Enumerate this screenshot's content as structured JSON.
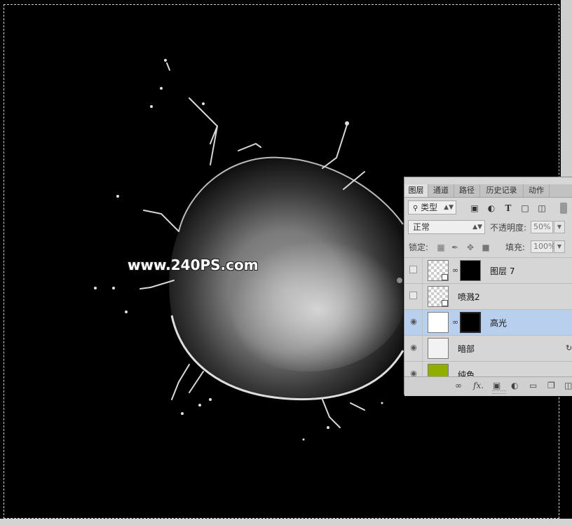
{
  "watermark": "www.240PS.com",
  "panel": {
    "tabs": [
      "图层",
      "通道",
      "路径",
      "历史记录",
      "动作"
    ],
    "filter_kind": "类型",
    "blend_mode": "正常",
    "opacity_label": "不透明度:",
    "opacity_value": "50%",
    "lock_label": "锁定:",
    "fill_label": "填充:",
    "fill_value": "100%",
    "layers": [
      {
        "name": "图层 7",
        "visible": false,
        "selected": false
      },
      {
        "name": "喷溅2",
        "visible": false,
        "selected": false
      },
      {
        "name": "高光",
        "visible": true,
        "selected": true
      },
      {
        "name": "暗部",
        "visible": true,
        "selected": false
      },
      {
        "name": "纯色",
        "visible": true,
        "selected": false
      }
    ],
    "footer_fx": "fx."
  },
  "colors": {
    "selected_layer": "#b8d0ee",
    "solid_color_swatch": "#8fae00"
  },
  "icons": {
    "filter": "search-icon",
    "tools": [
      "image-filter-icon",
      "adjustment-filter-icon",
      "type-filter-icon",
      "shape-filter-icon",
      "smart-object-filter-icon"
    ]
  }
}
